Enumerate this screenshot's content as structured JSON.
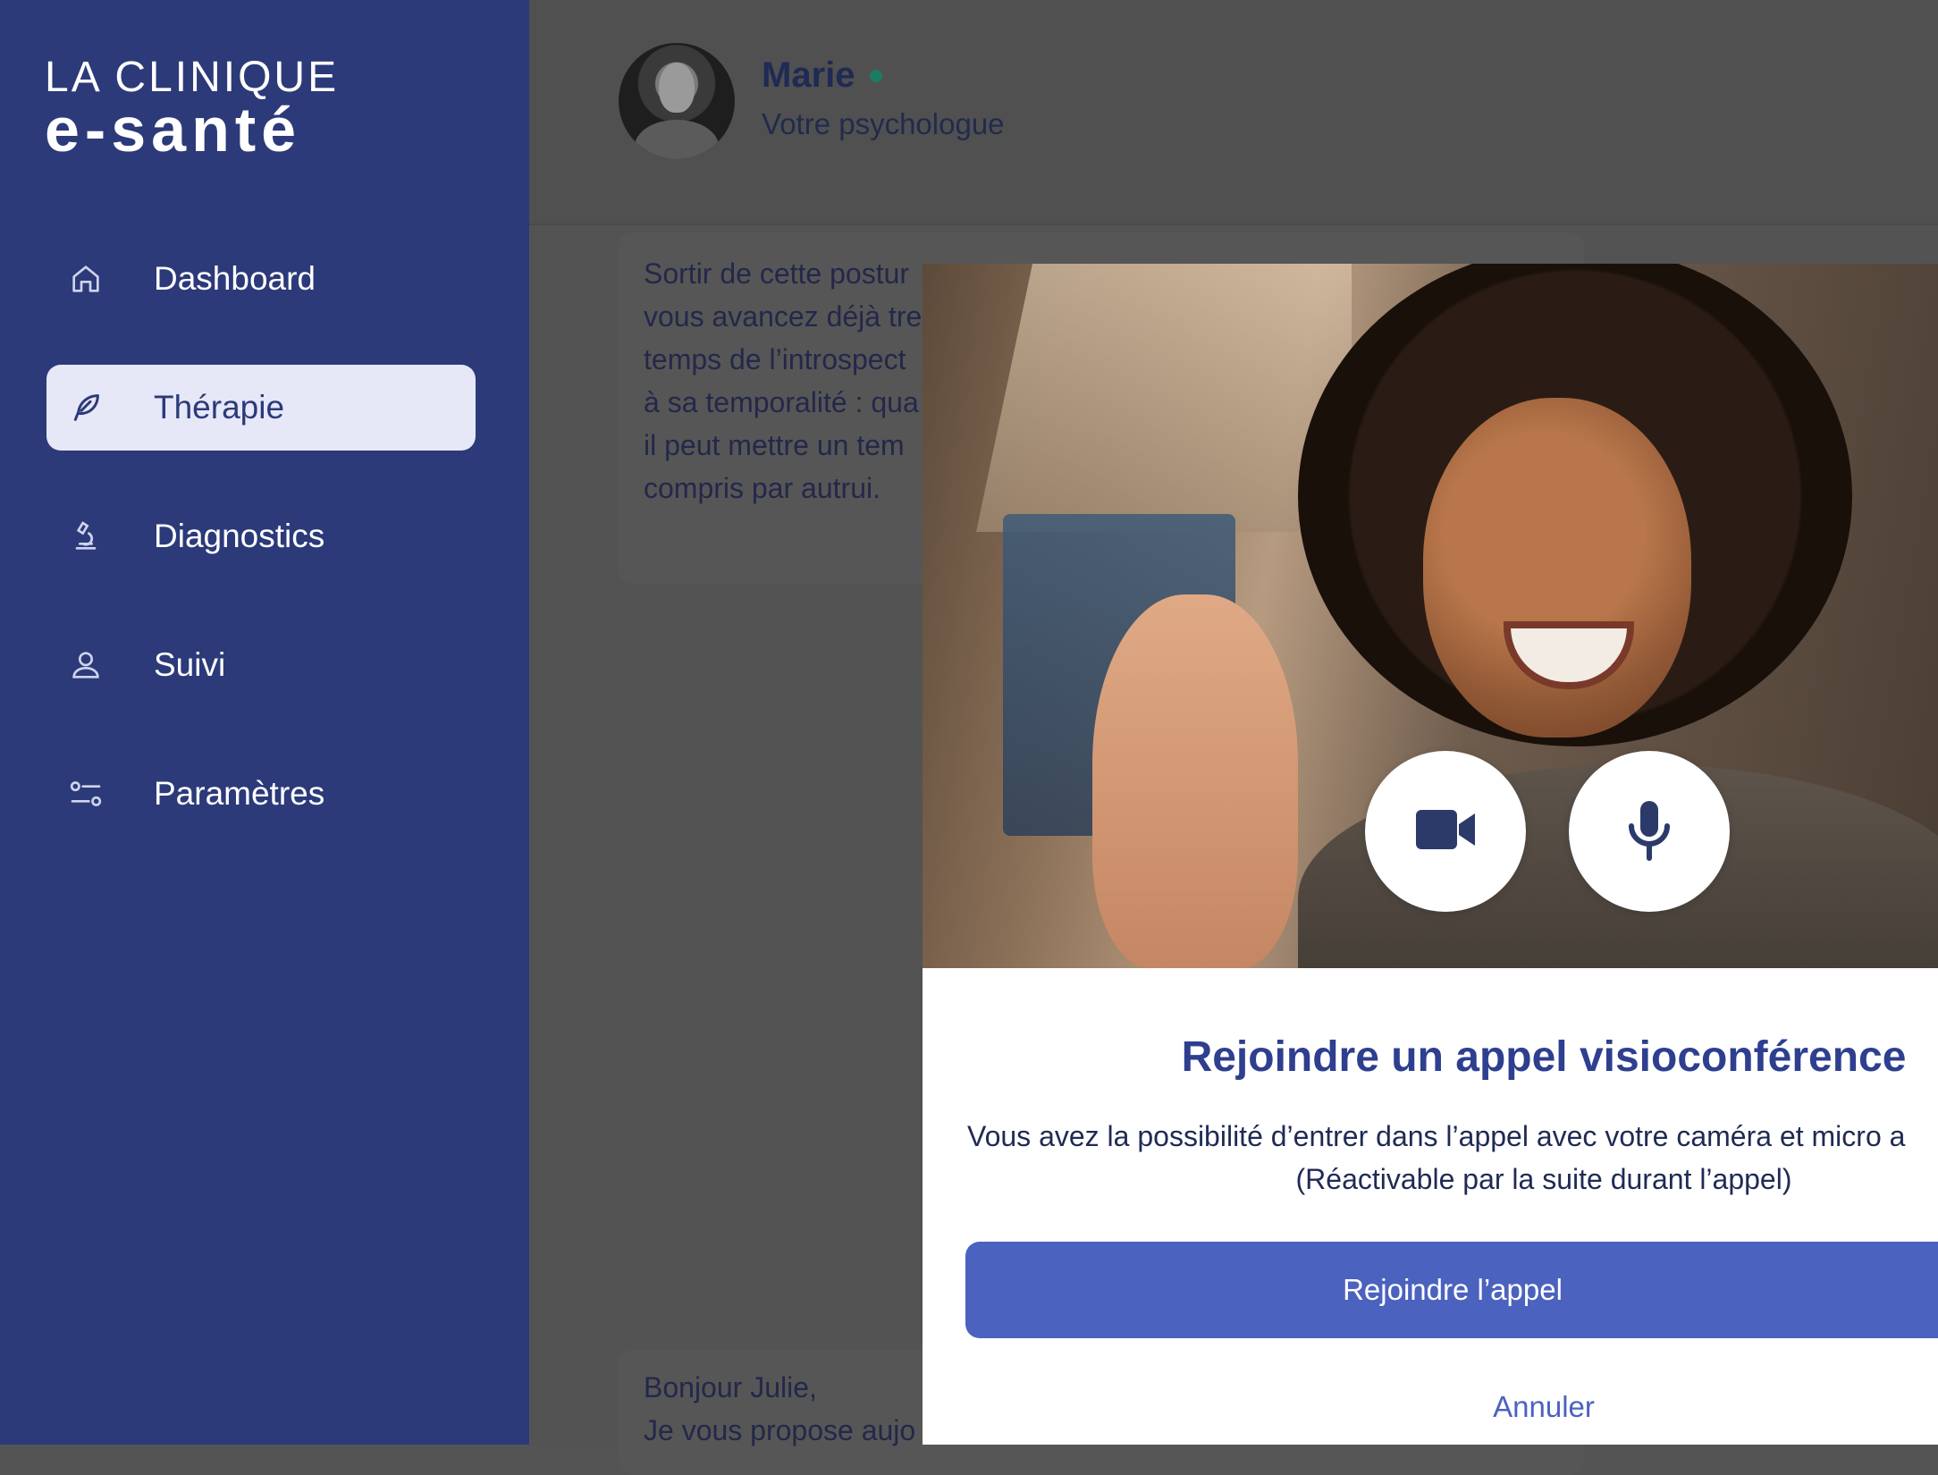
{
  "sidebar": {
    "logo": {
      "line1": "LA CLINIQUE",
      "line2": "e-santé"
    },
    "items": [
      {
        "label": "Dashboard",
        "icon": "home-icon",
        "active": false
      },
      {
        "label": "Thérapie",
        "icon": "feather-icon",
        "active": true
      },
      {
        "label": "Diagnostics",
        "icon": "microscope-icon",
        "active": false
      },
      {
        "label": "Suivi",
        "icon": "user-icon",
        "active": false
      },
      {
        "label": "Paramètres",
        "icon": "sliders-icon",
        "active": false
      }
    ]
  },
  "header": {
    "name": "Marie",
    "role": "Votre psychologue",
    "status_color": "#1d7a63"
  },
  "messages": [
    {
      "text": "Sortir de cette postur\nvous avancez déjà tre\ntemps de l’introspect\nà sa temporalité : qua\nil peut mettre un tem\ncompris par autrui."
    },
    {
      "text": "Bonjour Julie,\nJe vous propose aujo"
    }
  ],
  "modal": {
    "title": "Rejoindre un appel visioconférence",
    "description_line1": "Vous avez la possibilité d’entrer dans l’appel avec votre caméra et micro a",
    "description_line2": "(Réactivable par la suite durant l’appel)",
    "join_label": "Rejoindre l’appel",
    "cancel_label": "Annuler",
    "camera_icon": "video-camera-icon",
    "mic_icon": "microphone-icon"
  },
  "colors": {
    "sidebar_bg": "#2c3a79",
    "active_item_bg": "#e6e8f7",
    "accent": "#4b62bf",
    "title_color": "#2e3f8f"
  }
}
